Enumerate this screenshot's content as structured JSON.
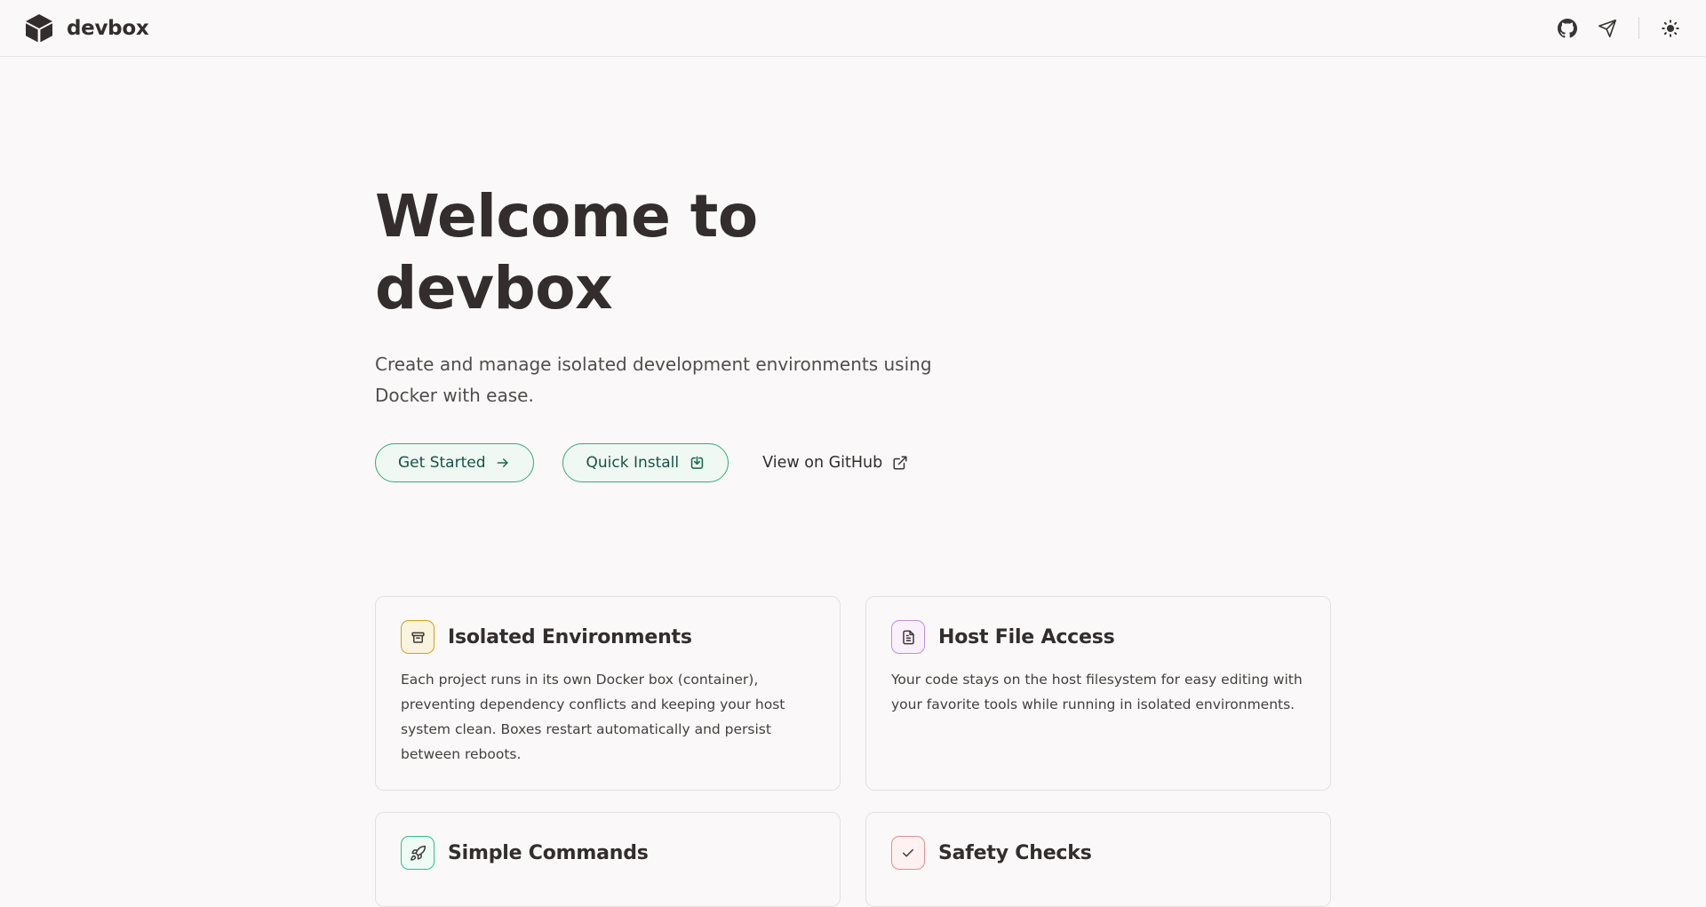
{
  "header": {
    "brand": "devbox",
    "nav_icons": [
      "github-icon",
      "telegram-icon",
      "theme-toggle-sun-icon"
    ]
  },
  "hero": {
    "title": "Welcome to devbox",
    "subtitle": "Create and manage isolated development environments using Docker with ease.",
    "primary_button": "Get Started",
    "secondary_button": "Quick Install",
    "github_link": "View on GitHub"
  },
  "features": [
    {
      "title": "Isolated Environments",
      "body": "Each project runs in its own Docker box (container), preventing dependency conflicts and keeping your host system clean. Boxes restart automatically and persist between reboots.",
      "icon": "box-icon",
      "accent": "#d4a019",
      "tint": "#faf3dd"
    },
    {
      "title": "Host File Access",
      "body": "Your code stays on the host filesystem for easy editing with your favorite tools while running in isolated environments.",
      "icon": "file-text-icon",
      "accent": "#c18fdf",
      "tint": "#f8f1fb"
    },
    {
      "title": "Simple Commands",
      "icon": "rocket-icon",
      "accent": "#2cc08f",
      "tint": "#effbf5"
    },
    {
      "title": "Safety Checks",
      "icon": "check-icon",
      "accent": "#e28f93",
      "tint": "#fdf1f2"
    }
  ],
  "colors": {
    "page_background": "#faf8f8",
    "button_border_green": "#3aa880",
    "button_background_mint": "#eff8f2",
    "button_text_teal": "#175349",
    "heading_text": "#332d2d",
    "card_border": "#e4e0e0"
  }
}
